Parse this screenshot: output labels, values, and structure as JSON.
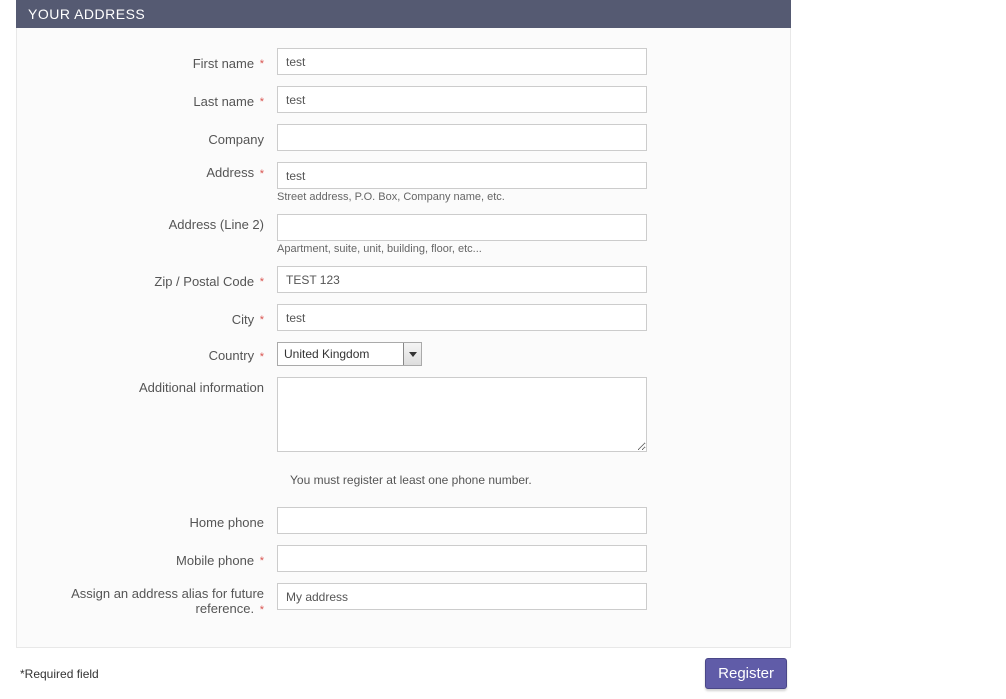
{
  "header": {
    "title": "YOUR ADDRESS"
  },
  "fields": {
    "first_name": {
      "label": "First name",
      "required": true,
      "value": "test"
    },
    "last_name": {
      "label": "Last name",
      "required": true,
      "value": "test"
    },
    "company": {
      "label": "Company",
      "required": false,
      "value": ""
    },
    "address1": {
      "label": "Address",
      "required": true,
      "value": "test",
      "hint": "Street address, P.O. Box, Company name, etc."
    },
    "address2": {
      "label": "Address (Line 2)",
      "required": false,
      "value": "",
      "hint": "Apartment, suite, unit, building, floor, etc..."
    },
    "postal": {
      "label": "Zip / Postal Code",
      "required": true,
      "value": "TEST 123"
    },
    "city": {
      "label": "City",
      "required": true,
      "value": "test"
    },
    "country": {
      "label": "Country",
      "required": true,
      "selected": "United Kingdom"
    },
    "additional": {
      "label": "Additional information",
      "required": false,
      "value": ""
    },
    "home_phone": {
      "label": "Home phone",
      "required": false,
      "value": ""
    },
    "mobile_phone": {
      "label": "Mobile phone",
      "required": true,
      "value": ""
    },
    "alias": {
      "label": "Assign an address alias for future reference.",
      "required": true,
      "value": "My address"
    }
  },
  "notices": {
    "phone_required": "You must register at least one phone number."
  },
  "footer": {
    "required_note": "*Required field",
    "register_label": "Register"
  },
  "required_marker": "*"
}
